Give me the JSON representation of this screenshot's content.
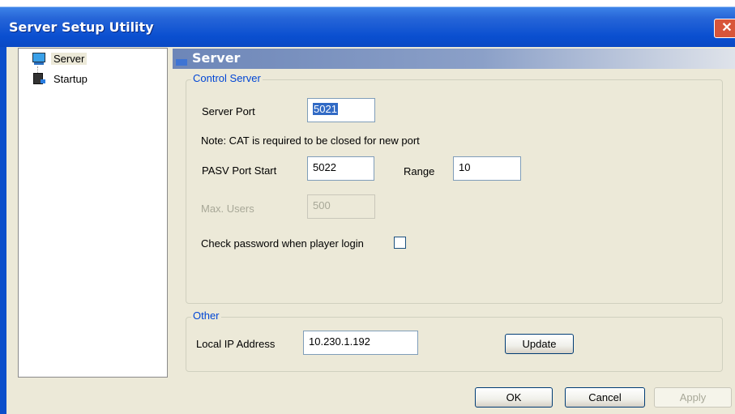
{
  "window": {
    "title": "Server Setup Utility",
    "close_glyph": "✕"
  },
  "tree": {
    "items": [
      {
        "label": "Server",
        "icon": "monitor-icon",
        "selected": true
      },
      {
        "label": "Startup",
        "icon": "startup-icon",
        "selected": false
      }
    ]
  },
  "panel": {
    "header": "Server",
    "control_server": {
      "legend": "Control Server",
      "server_port_label": "Server Port",
      "server_port_value": "5021",
      "note": "Note: CAT is required to be closed  for new port",
      "pasv_label": "PASV Port Start",
      "pasv_value": "5022",
      "range_label": "Range",
      "range_value": "10",
      "max_users_label": "Max. Users",
      "max_users_value": "500",
      "check_password_label": "Check password when player login",
      "check_password_checked": false
    },
    "other": {
      "legend": "Other",
      "ip_label": "Local IP Address",
      "ip_value": "10.230.1.192",
      "update_label": "Update"
    }
  },
  "footer": {
    "ok_label": "OK",
    "cancel_label": "Cancel",
    "apply_label": "Apply"
  },
  "colors": {
    "titlebar": "#0a4fd0",
    "legend_text": "#0046d5",
    "dialog_bg": "#ece9d8",
    "selection": "#316ac5"
  }
}
